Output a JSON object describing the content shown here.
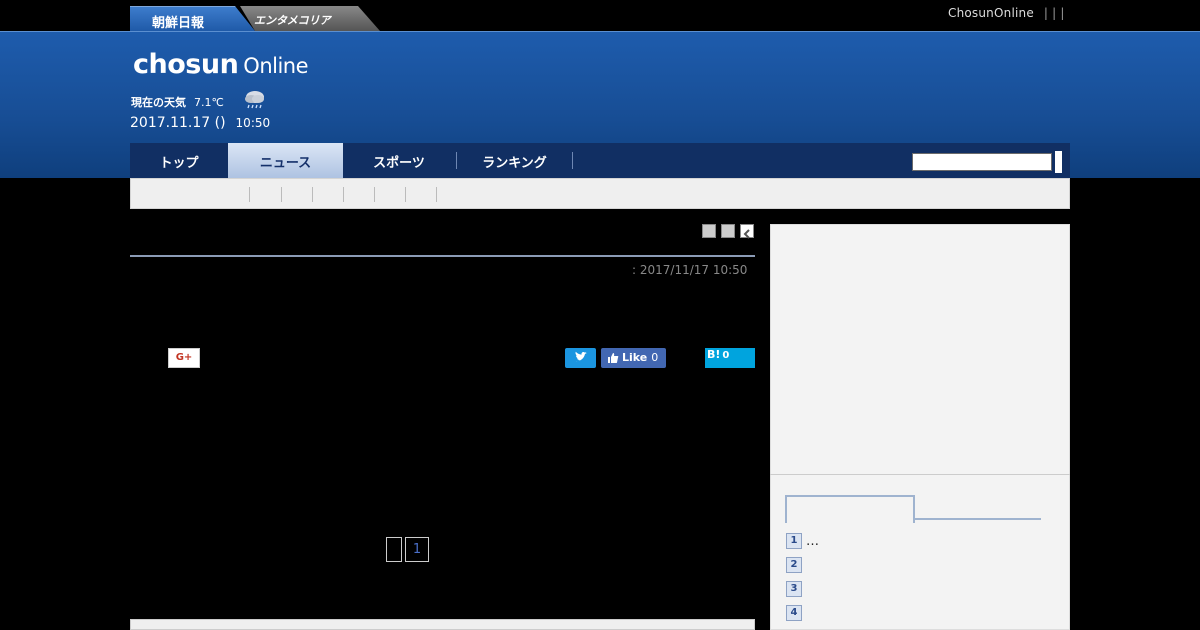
{
  "site_tabs": {
    "chosun_label": "朝鮮日報",
    "entame_label": "エンタメコリア"
  },
  "toplinks": {
    "site_label": "ChosunOnline",
    "separators": "| | |"
  },
  "logo": {
    "main": "chosun",
    "sub": "Online"
  },
  "weather": {
    "label": "現在の天気",
    "temperature": "7.1℃",
    "icon": "rain-cloud-icon"
  },
  "datetime": {
    "date": "2017.11.17 ()",
    "time": "10:50"
  },
  "nav": {
    "items": [
      {
        "label": "トップ"
      },
      {
        "label": "ニュース"
      },
      {
        "label": "スポーツ"
      },
      {
        "label": "ランキング"
      }
    ],
    "active_index": 1
  },
  "search": {
    "value": "",
    "placeholder": ""
  },
  "article": {
    "published": ": 2017/11/17 10:50"
  },
  "social": {
    "gplus_label": "G+",
    "facebook_label": "Like",
    "facebook_count": "0",
    "hatena_label": "B!",
    "hatena_count": "0"
  },
  "pager": {
    "prev_label": "",
    "current_page": "1"
  },
  "ranking": {
    "items": [
      {
        "rank": "1",
        "text": "…"
      },
      {
        "rank": "2",
        "text": ""
      },
      {
        "rank": "3",
        "text": ""
      },
      {
        "rank": "4",
        "text": ""
      }
    ]
  },
  "colors": {
    "header_blue": "#1e5cad",
    "nav_dark": "#112f63",
    "twitter": "#1b95e0",
    "facebook": "#4267b2",
    "hatena": "#00a4de"
  }
}
